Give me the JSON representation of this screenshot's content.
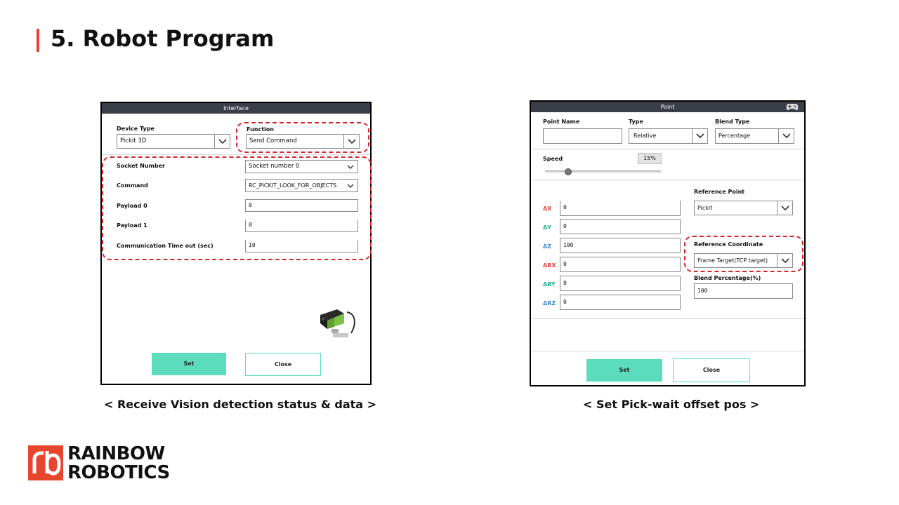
{
  "slide": {
    "title": "5. Robot Program",
    "caption_left": "< Receive Vision detection status & data >",
    "caption_right": "< Set Pick-wait offset pos >",
    "brand_line1": "RAINBOW",
    "brand_line2": "ROBOTICS",
    "accent_color": "#e8452f"
  },
  "interface_panel": {
    "header": "Interface",
    "device_type_label": "Device Type",
    "device_type_value": "Pickit 3D",
    "function_label": "Function",
    "function_value": "Send Command",
    "socket_label": "Socket Number",
    "socket_value": "Socket number 0",
    "command_label": "Command",
    "command_value": "RC_PICKIT_LOOK_FOR_OBJECTS",
    "payload0_label": "Payload 0",
    "payload0_value": "0",
    "payload1_label": "Payload 1",
    "payload1_value": "0",
    "timeout_label": "Communication Time out (sec)",
    "timeout_value": "10",
    "set_label": "Set",
    "close_label": "Close",
    "button_color": "#5cdcbc"
  },
  "point_panel": {
    "header": "Point",
    "point_name_label": "Point Name",
    "point_name_value": "",
    "type_label": "Type",
    "type_value": "Relative",
    "blend_type_label": "Blend Type",
    "blend_type_value": "Percentage",
    "speed_label": "Speed",
    "speed_value": "15%",
    "speed_fraction": 0.2,
    "dx_label": "ΔX",
    "dx_value": "0",
    "dy_label": "ΔY",
    "dy_value": "0",
    "dz_label": "ΔZ",
    "dz_value": "100",
    "drx_label": "ΔRX",
    "drx_value": "0",
    "dry_label": "ΔRY",
    "dry_value": "0",
    "drz_label": "ΔRZ",
    "drz_value": "0",
    "ref_point_label": "Reference Point",
    "ref_point_value": "Pickit",
    "ref_coord_label": "Reference Coordinate",
    "ref_coord_value": "Frame Target(TCP target)",
    "blend_pct_label": "Blend Percentage(%)",
    "blend_pct_value": "100",
    "set_label": "Set",
    "close_label": "Close",
    "gamepad_icon": "gamepad-icon",
    "delta_colors": {
      "red": "#e0463c",
      "green": "#1fae8a",
      "blue": "#3b86d1"
    }
  }
}
